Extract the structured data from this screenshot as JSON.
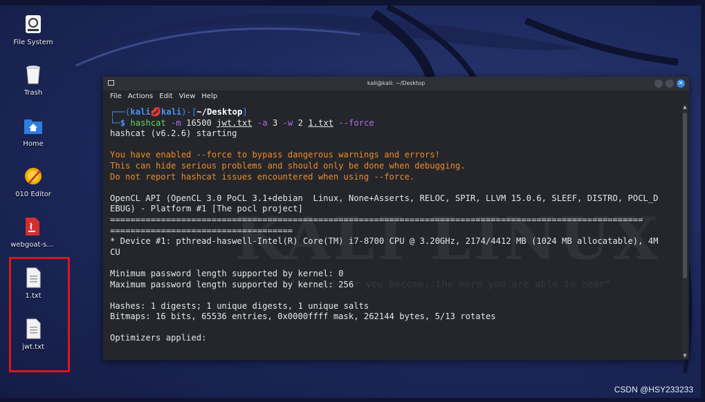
{
  "desktop": {
    "icons": [
      {
        "label": "File System",
        "icon": "drive-icon"
      },
      {
        "label": "Trash",
        "icon": "trash-icon"
      },
      {
        "label": "Home",
        "icon": "home-folder-icon"
      },
      {
        "label": "010 Editor",
        "icon": "010-editor-icon"
      },
      {
        "label": "webgoat-s...",
        "icon": "java-file-icon"
      },
      {
        "label": "1.txt",
        "icon": "text-file-icon"
      },
      {
        "label": "jwt.txt",
        "icon": "text-file-icon"
      }
    ]
  },
  "terminal": {
    "title": "kali@kali: ~/Desktop",
    "menu": [
      "File",
      "Actions",
      "Edit",
      "View",
      "Help"
    ],
    "prompt": {
      "user": "kali",
      "host": "kali",
      "skull": "💋",
      "path": "~/Desktop"
    },
    "command": {
      "bin": "hashcat",
      "flag_m": "-m",
      "mode": "16500",
      "hashfile": "jwt.txt",
      "flag_a": "-a",
      "attack": "3",
      "flag_w": "-w",
      "workload": "2",
      "maskfile": "1.txt",
      "flag_force": "--force"
    },
    "lines": {
      "starting": "hashcat (v6.2.6) starting",
      "warn1": "You have enabled --force to bypass dangerous warnings and errors!",
      "warn2": "This can hide serious problems and should only be done when debugging.",
      "warn3": "Do not report hashcat issues encountered when using --force.",
      "opencl1": "OpenCL API (OpenCL 3.0 PoCL 3.1+debian  Linux, None+Asserts, RELOC, SPIR, LLVM 15.0.6, SLEEF, DISTRO, POCL_D",
      "opencl2": "EBUG) - Platform #1 [The pocl project]",
      "sep1": "=========================================================================================================",
      "sep2": "====================================",
      "device1": "* Device #1: pthread-haswell-Intel(R) Core(TM) i7-8700 CPU @ 3.20GHz, 2174/4412 MB (1024 MB allocatable), 4M",
      "device2": "CU",
      "minpw": "Minimum password length supported by kernel: 0",
      "maxpw": "Maximum password length supported by kernel: 256",
      "hashes": "Hashes: 1 digests; 1 unique digests, 1 unique salts",
      "bitmaps": "Bitmaps: 16 bits, 65536 entries, 0x0000ffff mask, 262144 bytes, 5/13 rotates",
      "optimizers": "Optimizers applied:"
    },
    "watermark": "KALI LINUX",
    "watermark_sub": "\"the quieter you become, the more you are able to hear\""
  },
  "footer": {
    "credit": "CSDN @HSY233233"
  },
  "colors": {
    "highlight_border": "#e0141b",
    "terminal_bg": "#24262b",
    "warning": "#f08a24",
    "prompt_blue": "#3f8ef7"
  }
}
